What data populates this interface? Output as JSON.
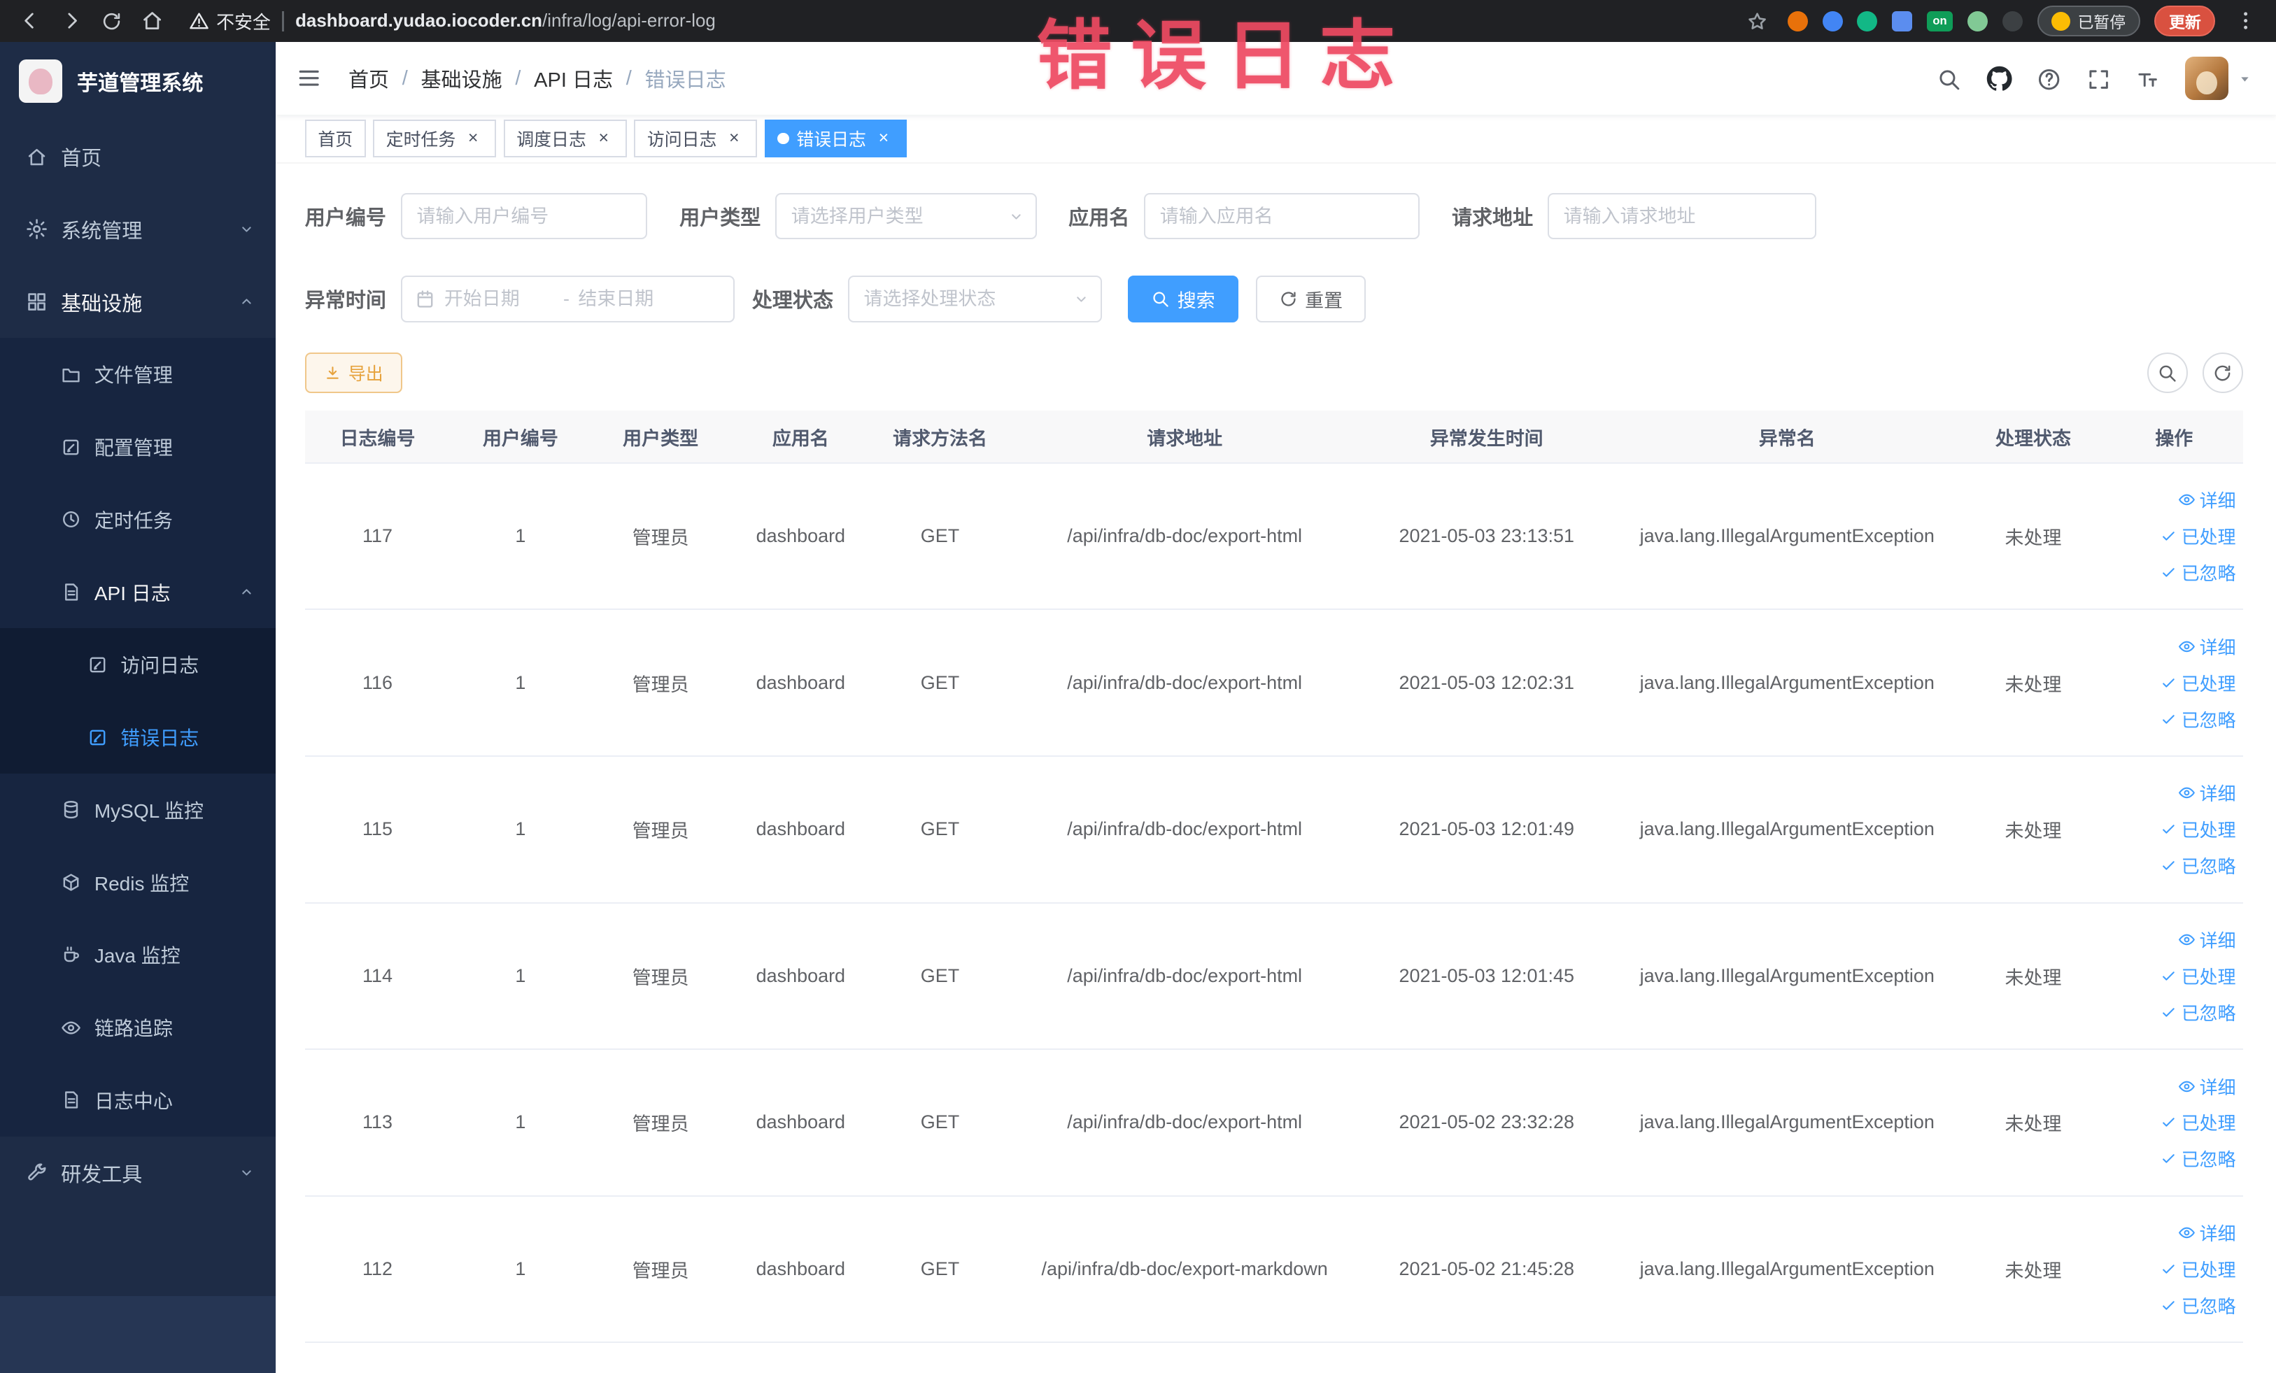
{
  "browser": {
    "security_label": "不安全",
    "url_domain": "dashboard.yudao.iocoder.cn",
    "url_path": "/infra/log/api-error-log",
    "extension_on_label": "on",
    "paused_label": "已暂停",
    "update_label": "更新"
  },
  "annotation": {
    "text": "错误日志"
  },
  "sidebar": {
    "title": "芋道管理系统",
    "items": [
      {
        "label": "首页"
      },
      {
        "label": "系统管理"
      },
      {
        "label": "基础设施"
      },
      {
        "label": "文件管理"
      },
      {
        "label": "配置管理"
      },
      {
        "label": "定时任务"
      },
      {
        "label": "API 日志"
      },
      {
        "label": "访问日志"
      },
      {
        "label": "错误日志"
      },
      {
        "label": "MySQL 监控"
      },
      {
        "label": "Redis 监控"
      },
      {
        "label": "Java 监控"
      },
      {
        "label": "链路追踪"
      },
      {
        "label": "日志中心"
      },
      {
        "label": "研发工具"
      }
    ]
  },
  "navbar": {
    "breadcrumb": [
      "首页",
      "基础设施",
      "API 日志",
      "错误日志"
    ],
    "breadcrumb_separator": "/"
  },
  "tabs": [
    {
      "label": "首页"
    },
    {
      "label": "定时任务"
    },
    {
      "label": "调度日志"
    },
    {
      "label": "访问日志"
    },
    {
      "label": "错误日志"
    }
  ],
  "filters": {
    "user_id": {
      "label": "用户编号",
      "placeholder": "请输入用户编号",
      "value": ""
    },
    "user_type": {
      "label": "用户类型",
      "placeholder": "请选择用户类型",
      "value": ""
    },
    "app_name": {
      "label": "应用名",
      "placeholder": "请输入应用名",
      "value": ""
    },
    "request_url": {
      "label": "请求地址",
      "placeholder": "请输入请求地址",
      "value": ""
    },
    "exception_time": {
      "label": "异常时间",
      "start_placeholder": "开始日期",
      "separator": "-",
      "end_placeholder": "结束日期"
    },
    "process_status": {
      "label": "处理状态",
      "placeholder": "请选择处理状态",
      "value": ""
    },
    "search_label": "搜索",
    "reset_label": "重置"
  },
  "toolbar": {
    "export_label": "导出"
  },
  "table": {
    "columns": [
      "日志编号",
      "用户编号",
      "用户类型",
      "应用名",
      "请求方法名",
      "请求地址",
      "异常发生时间",
      "异常名",
      "处理状态",
      "操作"
    ],
    "action_labels": [
      "详细",
      "已处理",
      "已忽略"
    ],
    "rows": [
      {
        "id": "117",
        "user_id": "1",
        "user_type": "管理员",
        "app": "dashboard",
        "method": "GET",
        "url": "/api/infra/db-doc/export-html",
        "time": "2021-05-03 23:13:51",
        "exception": "java.lang.IllegalArgumentException",
        "status": "未处理"
      },
      {
        "id": "116",
        "user_id": "1",
        "user_type": "管理员",
        "app": "dashboard",
        "method": "GET",
        "url": "/api/infra/db-doc/export-html",
        "time": "2021-05-03 12:02:31",
        "exception": "java.lang.IllegalArgumentException",
        "status": "未处理"
      },
      {
        "id": "115",
        "user_id": "1",
        "user_type": "管理员",
        "app": "dashboard",
        "method": "GET",
        "url": "/api/infra/db-doc/export-html",
        "time": "2021-05-03 12:01:49",
        "exception": "java.lang.IllegalArgumentException",
        "status": "未处理"
      },
      {
        "id": "114",
        "user_id": "1",
        "user_type": "管理员",
        "app": "dashboard",
        "method": "GET",
        "url": "/api/infra/db-doc/export-html",
        "time": "2021-05-03 12:01:45",
        "exception": "java.lang.IllegalArgumentException",
        "status": "未处理"
      },
      {
        "id": "113",
        "user_id": "1",
        "user_type": "管理员",
        "app": "dashboard",
        "method": "GET",
        "url": "/api/infra/db-doc/export-html",
        "time": "2021-05-02 23:32:28",
        "exception": "java.lang.IllegalArgumentException",
        "status": "未处理"
      },
      {
        "id": "112",
        "user_id": "1",
        "user_type": "管理员",
        "app": "dashboard",
        "method": "GET",
        "url": "/api/infra/db-doc/export-markdown",
        "time": "2021-05-02 21:45:28",
        "exception": "java.lang.IllegalArgumentException",
        "status": "未处理"
      }
    ]
  },
  "colors": {
    "accent": "#409eff",
    "warning": "#e6a23c",
    "sidebar_bg": "#1e2c46",
    "annotation_red": "#ee4a62"
  }
}
